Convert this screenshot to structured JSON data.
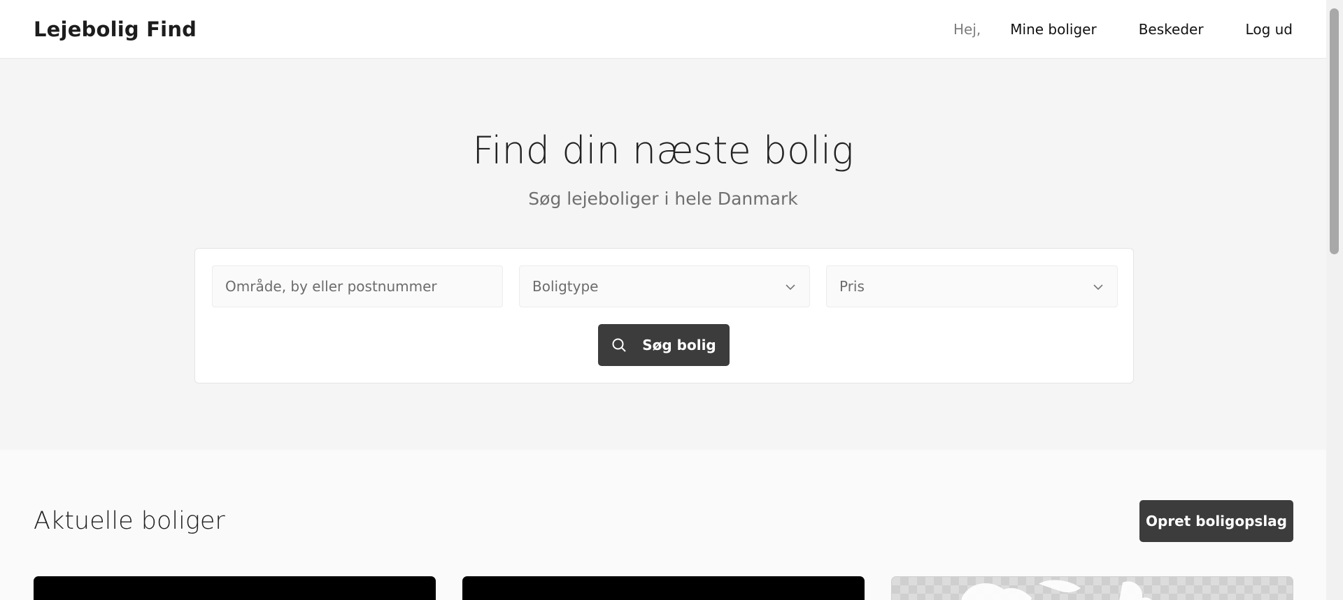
{
  "header": {
    "logo": "Lejebolig Find",
    "greeting": "Hej,",
    "nav": [
      "Mine boliger",
      "Beskeder",
      "Log ud"
    ]
  },
  "hero": {
    "title": "Find din næste bolig",
    "subtitle": "Søg lejeboliger i hele Danmark"
  },
  "search": {
    "area_placeholder": "Område, by eller postnummer",
    "type_selected": "Boligtype",
    "price_selected": "Pris",
    "button_label": "Søg bolig"
  },
  "listings": {
    "title": "Aktuelle boliger",
    "create_button": "Opret boligopslag"
  },
  "icons": {
    "search": "search-icon",
    "chevron": "chevron-down-icon"
  },
  "colors": {
    "button_bg": "#3c3c3c",
    "hero_bg": "#f5f5f5"
  }
}
